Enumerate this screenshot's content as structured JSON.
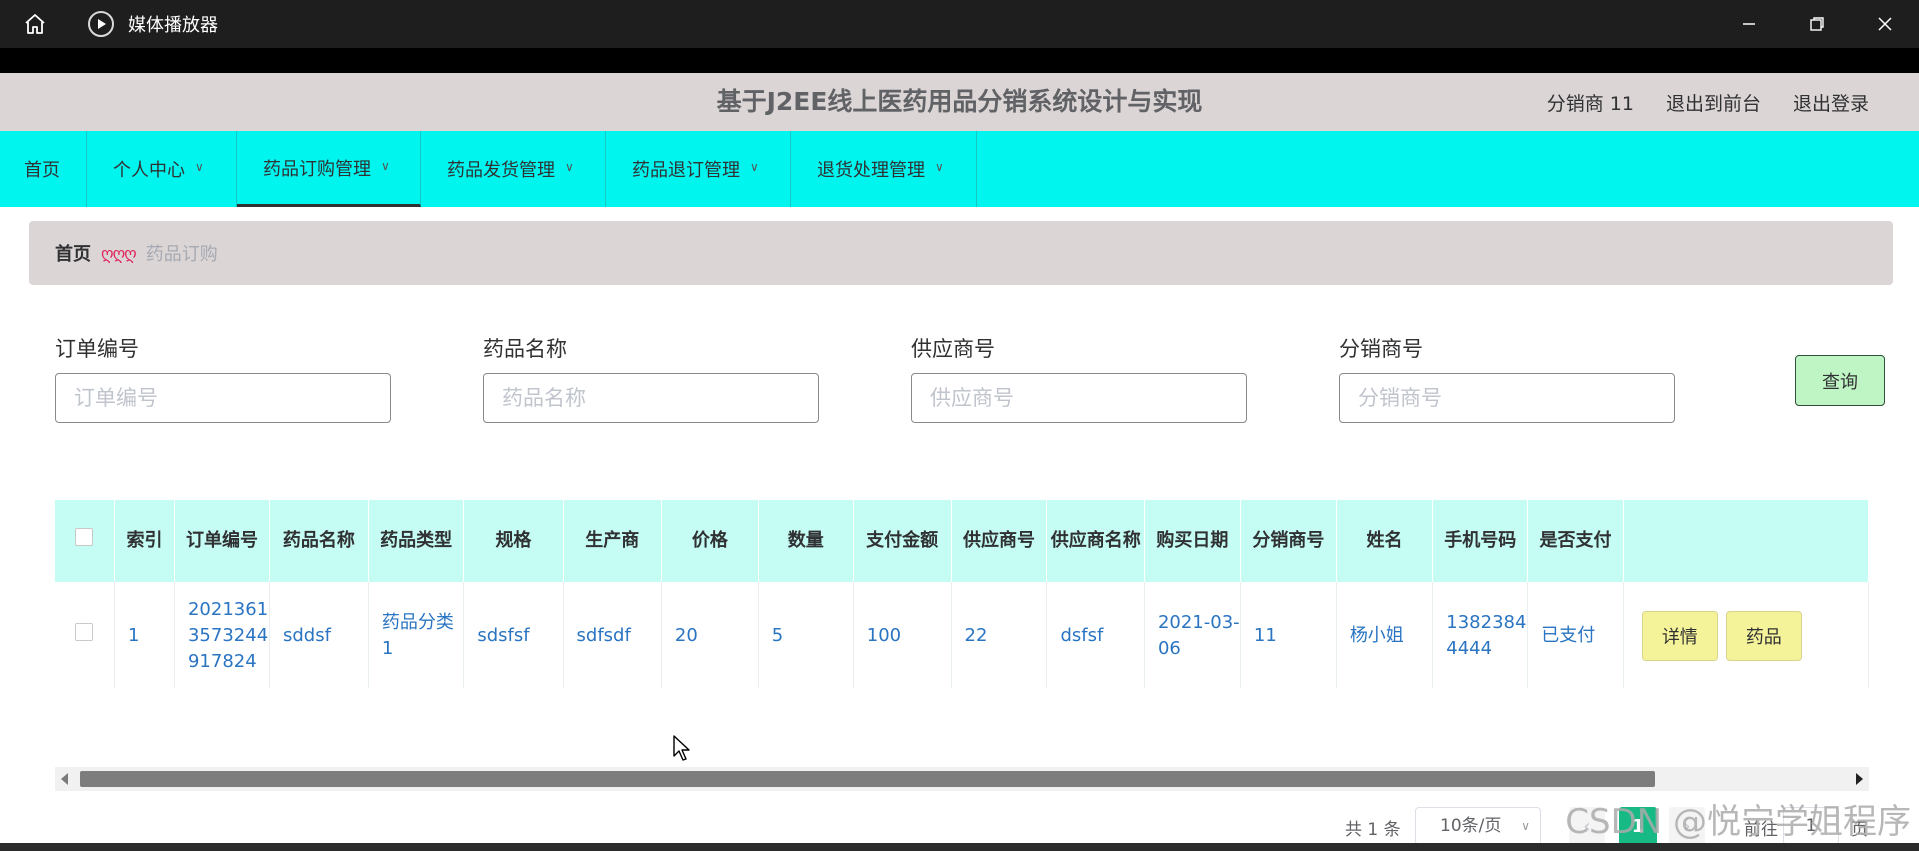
{
  "window": {
    "title": "媒体播放器"
  },
  "header": {
    "site_title": "基于J2EE线上医药用品分销系统设计与实现",
    "user": "分销商 11",
    "to_front": "退出到前台",
    "logout": "退出登录"
  },
  "nav": {
    "items": [
      {
        "label": "首页"
      },
      {
        "label": "个人中心"
      },
      {
        "label": "药品订购管理"
      },
      {
        "label": "药品发货管理"
      },
      {
        "label": "药品退订管理"
      },
      {
        "label": "退货处理管理"
      }
    ]
  },
  "breadcrumb": {
    "home": "首页",
    "separator": "ღღღ",
    "current": "药品订购"
  },
  "search": {
    "fields": [
      {
        "label": "订单编号",
        "placeholder": "订单编号"
      },
      {
        "label": "药品名称",
        "placeholder": "药品名称"
      },
      {
        "label": "供应商号",
        "placeholder": "供应商号"
      },
      {
        "label": "分销商号",
        "placeholder": "分销商号"
      }
    ],
    "query_label": "查询"
  },
  "table": {
    "headers": [
      "索引",
      "订单编号",
      "药品名称",
      "药品类型",
      "规格",
      "生产商",
      "价格",
      "数量",
      "支付金额",
      "供应商号",
      "供应商名称",
      "购买日期",
      "分销商号",
      "姓名",
      "手机号码",
      "是否支付"
    ],
    "rows": [
      {
        "index": "1",
        "order_no": "20213613573244917824",
        "drug_name": "sddsf",
        "drug_type": "药品分类1",
        "spec": "sdsfsf",
        "maker": "sdfsdf",
        "price": "20",
        "qty": "5",
        "amount": "100",
        "supplier_no": "22",
        "supplier_name": "dsfsf",
        "buy_date": "2021-03-06",
        "distributor_no": "11",
        "name": "杨小姐",
        "phone": "13823844444",
        "paid": "已支付",
        "actions": [
          "详情",
          "药品"
        ]
      }
    ]
  },
  "pagination": {
    "total": "共 1 条",
    "page_size": "10条/页",
    "current": "1",
    "goto_prefix": "前往",
    "goto_value": "1",
    "goto_suffix": "页"
  },
  "watermark": "CSDN @悦宁学姐程序",
  "colors": {
    "nav_bg": "#00f5ef",
    "header_bg": "#dcd5d5",
    "table_header_bg": "#c5fdf5",
    "link_blue": "#2a74c2",
    "page_active": "#17b985",
    "query_btn": "#bff5c4",
    "op_btn": "#f5f39a"
  }
}
